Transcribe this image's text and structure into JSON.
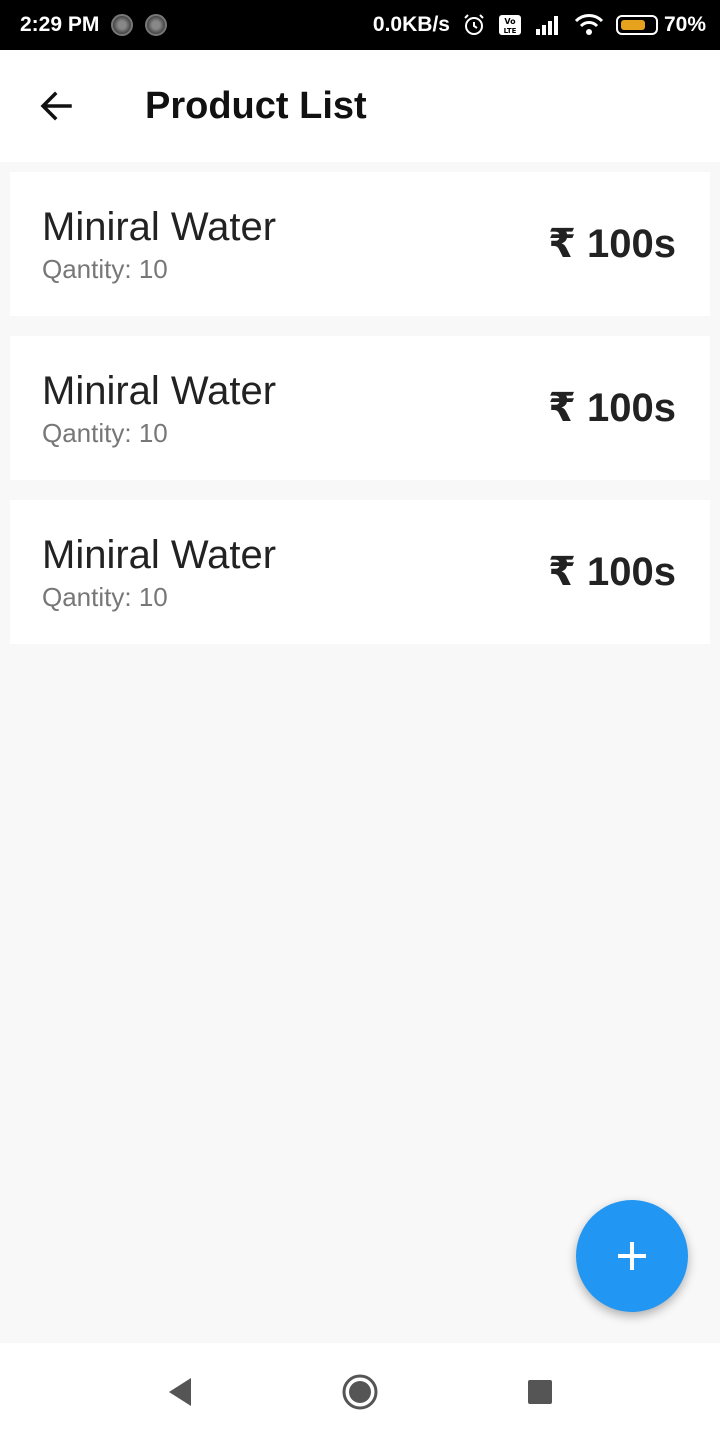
{
  "status_bar": {
    "time": "2:29 PM",
    "network_speed": "0.0KB/s",
    "battery_percent": "70%",
    "battery_level": 0.7,
    "icons": [
      "notification-icon",
      "notification-icon",
      "alarm-icon",
      "volte-icon",
      "signal-icon",
      "wifi-icon",
      "battery-icon"
    ]
  },
  "app_bar": {
    "title": "Product List",
    "back_icon": "arrow-left-icon"
  },
  "products": [
    {
      "name": "Miniral Water",
      "quantity": "Qantity: 10",
      "price": "₹ 100s"
    },
    {
      "name": "Miniral Water",
      "quantity": "Qantity: 10",
      "price": "₹ 100s"
    },
    {
      "name": "Miniral Water",
      "quantity": "Qantity: 10",
      "price": "₹ 100s"
    }
  ],
  "fab": {
    "icon": "plus-icon",
    "color": "#2196f3"
  },
  "nav_bar": {
    "icons": [
      "back-triangle-icon",
      "home-circle-icon",
      "recents-square-icon"
    ]
  }
}
